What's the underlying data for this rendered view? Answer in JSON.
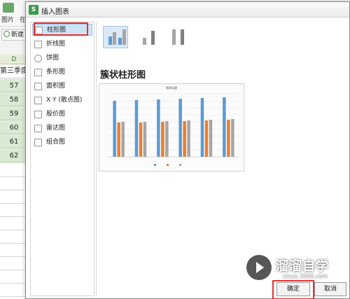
{
  "background": {
    "tab_picture": "图片",
    "tab_partial": "在",
    "new_button": "新建",
    "column_header": "D",
    "header_cell": "第三季度",
    "cells": [
      "57",
      "58",
      "59",
      "60",
      "61",
      "62"
    ]
  },
  "dialog": {
    "title": "插入图表",
    "categories": [
      {
        "label": "柱形图",
        "icon": "bar-chart-icon"
      },
      {
        "label": "折线图",
        "icon": "line-chart-icon"
      },
      {
        "label": "饼图",
        "icon": "pie-chart-icon"
      },
      {
        "label": "条形图",
        "icon": "horizontal-bar-icon"
      },
      {
        "label": "面积图",
        "icon": "area-chart-icon"
      },
      {
        "label": "X Y (散点图)",
        "icon": "scatter-chart-icon"
      },
      {
        "label": "股价图",
        "icon": "stock-chart-icon"
      },
      {
        "label": "雷达图",
        "icon": "radar-chart-icon"
      },
      {
        "label": "组合图",
        "icon": "combo-chart-icon"
      }
    ],
    "selected_variant_title": "簇状柱形图",
    "preview_title": "图表标题",
    "ok_label": "确定",
    "cancel_label": "取消"
  },
  "colors": {
    "series1": "#5b9bd5",
    "series2": "#ed7d31",
    "series3": "#a5a5a5",
    "highlight": "#e53030"
  },
  "watermark": {
    "text": "溜溜自学",
    "url": "zixue.3066.com"
  },
  "chart_data": {
    "type": "bar",
    "title": "图表标题",
    "categories": [
      "",
      "",
      "",
      "",
      "",
      ""
    ],
    "series": [
      {
        "values": [
          80,
          81,
          82,
          83,
          84,
          85
        ]
      },
      {
        "values": [
          49,
          49,
          50,
          51,
          52,
          53
        ]
      },
      {
        "values": [
          50,
          50,
          51,
          52,
          53,
          54
        ]
      }
    ],
    "ylim": [
      0,
      90
    ],
    "grid": true,
    "legend": "bottom"
  }
}
